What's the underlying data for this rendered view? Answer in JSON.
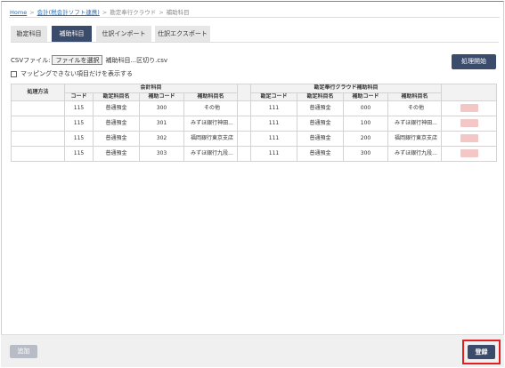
{
  "breadcrumb": {
    "home": "Home",
    "item1": "会計(税会計ソフト連携)",
    "item2": "勘定奉行クラウド",
    "current": "補助科目"
  },
  "tabs": [
    {
      "label": "勘定科目",
      "active": false
    },
    {
      "label": "補助科目",
      "active": true
    },
    {
      "label": "仕訳インポート",
      "active": false
    },
    {
      "label": "仕訳エクスポート",
      "active": false
    }
  ],
  "toolbar": {
    "process_label": "処理開始",
    "csv_label": "CSVファイル:",
    "file_button": "ファイルを選択",
    "file_name": "補助科目...区切り.csv",
    "unmapped_only_label": "マッピングできない項目だけを表示する"
  },
  "table": {
    "col_method": "処理方法",
    "group_left": "会計科目",
    "group_right": "勘定奉行クラウド補助科目",
    "col_code": "コード",
    "col_account_name": "勘定科目名",
    "col_sub_code": "補助コード",
    "col_sub_name": "補助科目名",
    "col_r_code": "勘定コード",
    "col_r_account_name": "勘定科目名",
    "col_r_sub_code": "補助コード",
    "col_r_sub_name": "補助科目名",
    "rows": [
      {
        "code": "115",
        "account": "普通預金",
        "sub_code": "300",
        "sub_name": "その他",
        "r_code": "111",
        "r_account": "普通預金",
        "r_sub_code": "000",
        "r_sub_name": "その他"
      },
      {
        "code": "115",
        "account": "普通預金",
        "sub_code": "301",
        "sub_name": "みずほ銀行神田...",
        "r_code": "111",
        "r_account": "普通預金",
        "r_sub_code": "100",
        "r_sub_name": "みずほ銀行神田..."
      },
      {
        "code": "115",
        "account": "普通預金",
        "sub_code": "302",
        "sub_name": "福岡銀行東京支店",
        "r_code": "111",
        "r_account": "普通預金",
        "r_sub_code": "200",
        "r_sub_name": "福岡銀行東京支店"
      },
      {
        "code": "115",
        "account": "普通預金",
        "sub_code": "303",
        "sub_name": "みずほ銀行九段...",
        "r_code": "111",
        "r_account": "普通預金",
        "r_sub_code": "300",
        "r_sub_name": "みずほ銀行九段..."
      }
    ]
  },
  "footer": {
    "add_label": "追加",
    "register_label": "登録"
  },
  "colors": {
    "primary": "#3b4b6b",
    "highlight": "#e02020",
    "delete": "#f4c7c7"
  }
}
